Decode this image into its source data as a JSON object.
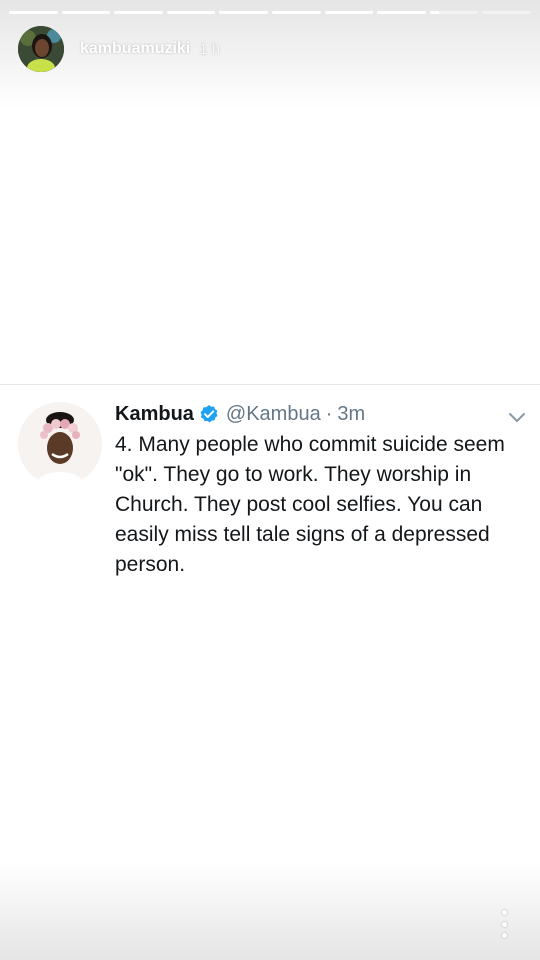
{
  "story": {
    "username": "kambuamuziki",
    "time_ago": "1 h",
    "progress_segments": 10,
    "current_segment": 9,
    "current_segment_fraction": 0.2
  },
  "tweet": {
    "name": "Kambua",
    "verified": true,
    "handle": "@Kambua",
    "separator": "·",
    "time": "3m",
    "text": "4. Many people who commit suicide seem \"ok\". They go to work. They worship in Church. They post cool selfies. You can easily miss tell tale signs of a depressed person."
  },
  "colors": {
    "verified": "#1da1f2",
    "text": "#14171a",
    "secondary": "#657786"
  },
  "icons": {
    "verified": "verified-badge-icon",
    "chevron": "chevron-down-icon",
    "more": "more-vertical-icon"
  }
}
